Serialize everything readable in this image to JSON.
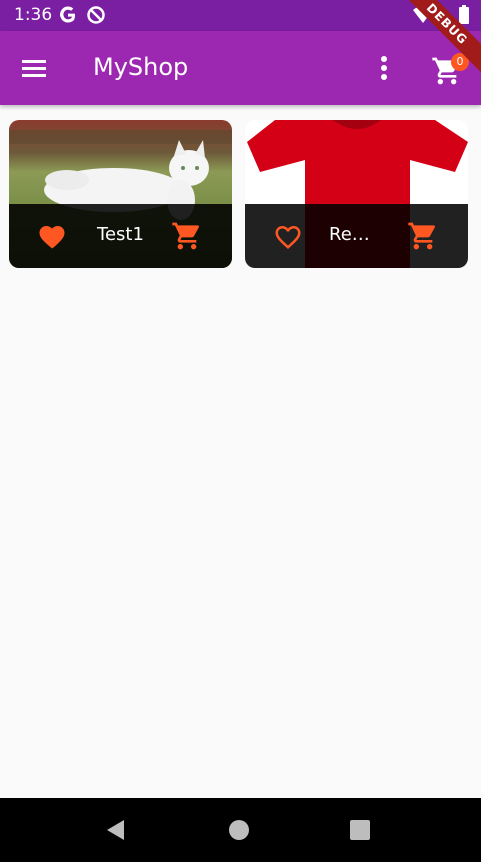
{
  "status_bar": {
    "time": "1:36",
    "icons": [
      "google-g-icon",
      "data-saver-icon",
      "wifi-icon",
      "battery-icon"
    ]
  },
  "debug_banner": {
    "label": "DEBUG"
  },
  "app_bar": {
    "title": "MyShop",
    "color": "#9c27b0",
    "icons": [
      "menu-icon",
      "more-vert-icon",
      "shopping-cart-icon"
    ],
    "cart_badge": "0"
  },
  "products": [
    {
      "title": "Test1",
      "favorite": true,
      "image": "white cat on grass"
    },
    {
      "title": "Red Shirt",
      "favorite": false,
      "image": "red t-shirt"
    }
  ],
  "accent_color": "#ff5722",
  "nav_bar": {
    "icons": [
      "back-icon",
      "home-icon",
      "recents-icon"
    ]
  }
}
